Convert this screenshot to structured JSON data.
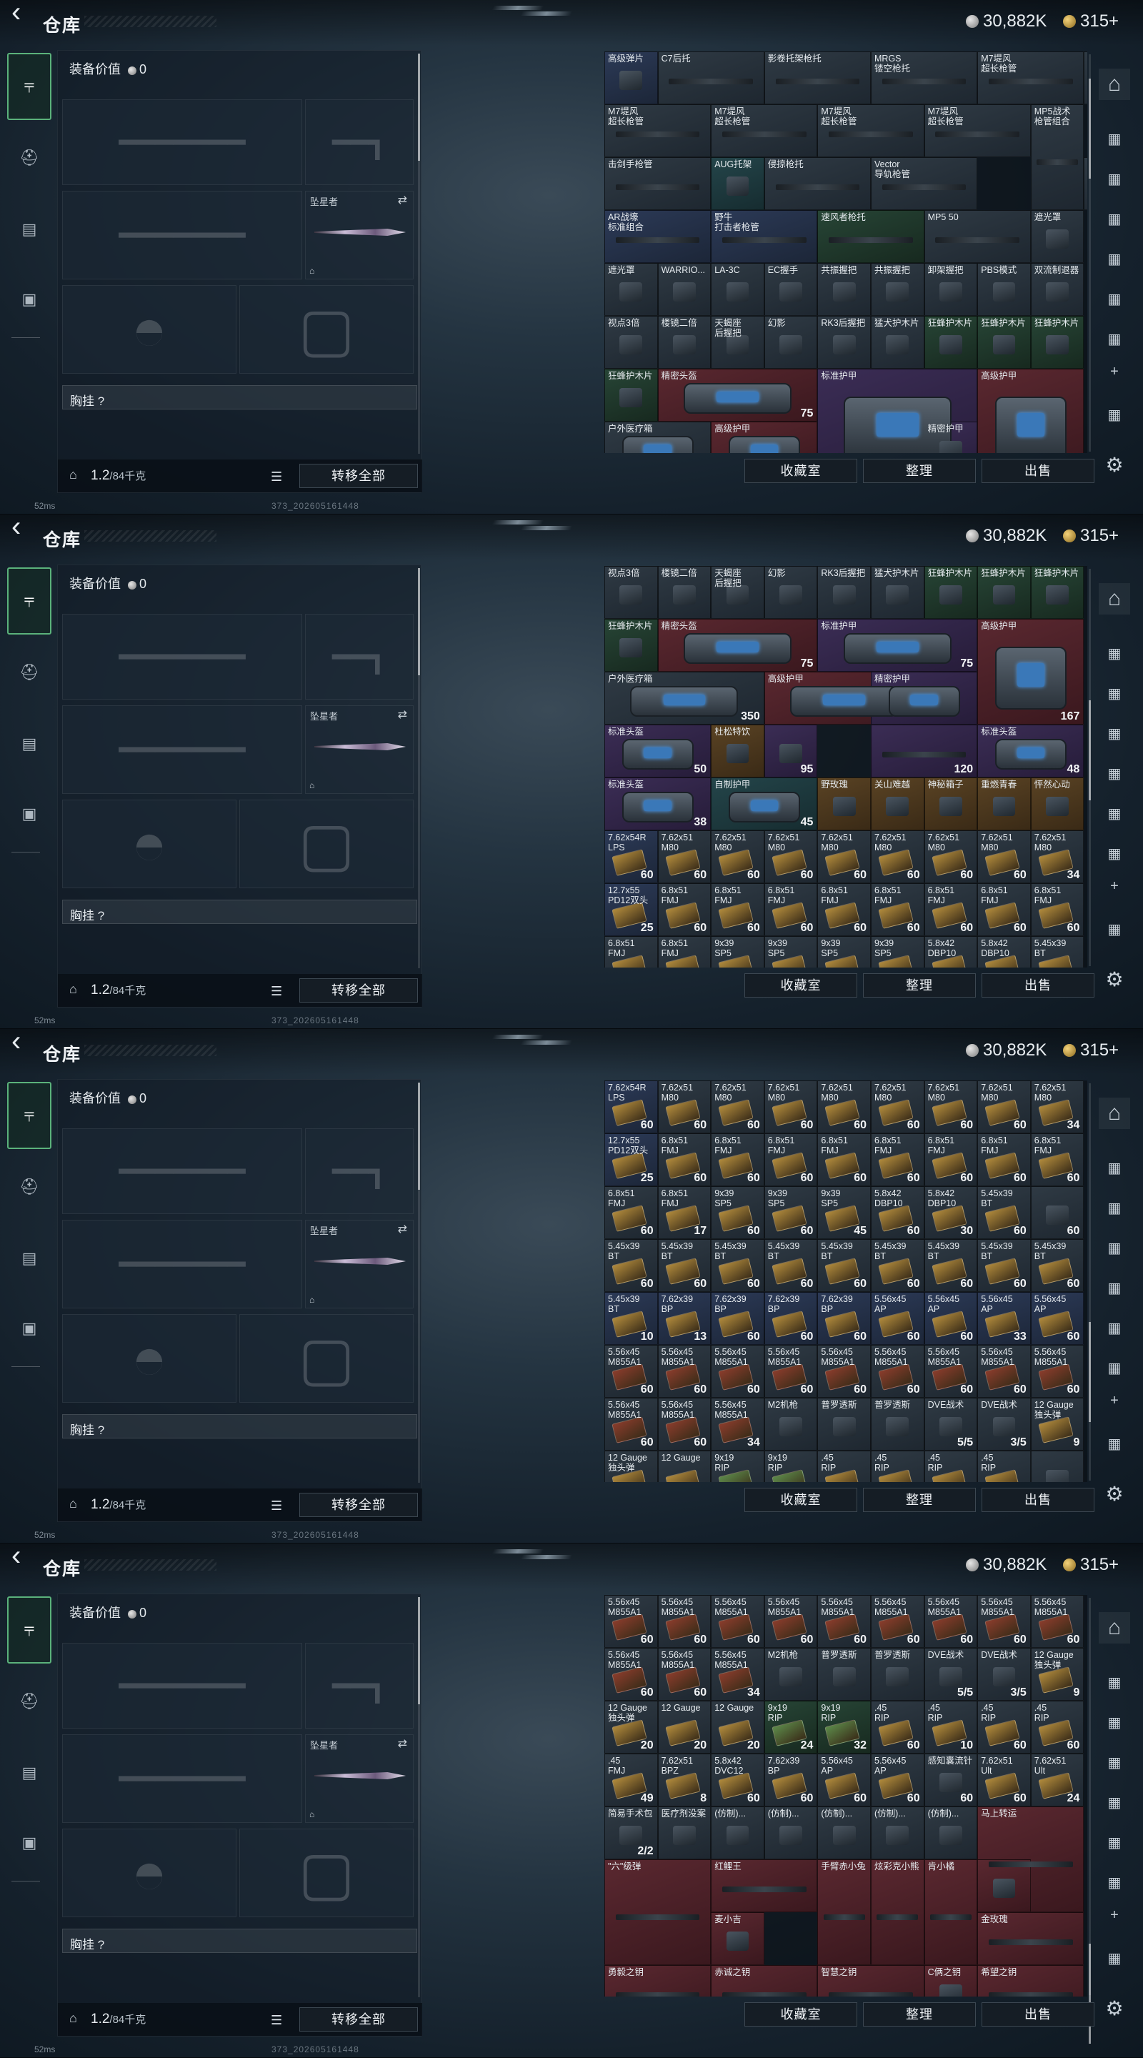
{
  "header": {
    "title": "仓库",
    "silver": "30,882K",
    "gold": "315+"
  },
  "loadout": {
    "equip_value_label": "装备价值",
    "equip_value": "0",
    "melee_label": "坠星者",
    "chest_rig_label": "胸挂 ?",
    "weight": "1.2",
    "weight_max": "/84千克",
    "transfer_all": "转移全部"
  },
  "footer": {
    "collection": "收藏室",
    "sort": "整理",
    "sell": "出售"
  },
  "status": {
    "ping": "52ms",
    "build": "373_202605161448"
  },
  "colors": {
    "accent_green": "#5bb27b",
    "bg_dark": "#0f1a24"
  },
  "icons": {
    "back": "back-arrow-icon",
    "weapon": "gun-icon",
    "helmet": "helmet-icon",
    "backpack": "backpack-icon",
    "briefcase": "briefcase-icon",
    "home": "home-icon",
    "settings": "gear-icon",
    "add": "plus-icon",
    "list": "list-icon",
    "lock": "lock-icon",
    "swap": "swap-icon"
  },
  "screens": [
    {
      "cells": [
        [
          "高级弹片",
          "",
          "blue"
        ],
        [
          "C7后托",
          "",
          "gray"
        ],
        [
          "影卷托架枪托",
          "",
          "gray"
        ],
        [
          "MRGS\n镂空枪托",
          "",
          "gray"
        ],
        [
          "M7堤风\n超长枪管",
          "",
          "gray"
        ],
        [
          "",
          "",
          "gray"
        ],
        [
          "M7堤风\n超长枪管",
          "",
          "gray"
        ],
        [
          "M7堤风\n超长枪管",
          "",
          "gray"
        ],
        [
          "M7堤风\n超长枪管",
          "",
          "gray"
        ],
        [
          "M7堤风\n超长枪管",
          "",
          "gray"
        ],
        [
          "MP5战术\n枪管组合",
          "",
          "gray"
        ],
        [
          "击剑手枪管",
          "",
          "gray"
        ],
        [
          "AUG托架",
          "",
          "teal"
        ],
        [
          "侵掠枪托",
          "",
          "gray"
        ],
        [
          "Vector\n导轨枪管",
          "",
          "gray"
        ],
        [
          "",
          "",
          "gray"
        ],
        [
          "AR战壕\n标准组合",
          "",
          "blue"
        ],
        [
          "野牛\n打击者枪管",
          "",
          "blue"
        ],
        [
          "速风者枪托",
          "",
          "green"
        ],
        [
          "MP5 50",
          "",
          "gray"
        ],
        [
          "遮光罩",
          "",
          "gray"
        ],
        [
          "遮光罩",
          "",
          "gray"
        ],
        [
          "WARRIO...",
          "",
          "gray"
        ],
        [
          "LA-3C",
          "",
          "gray"
        ],
        [
          "EC握手",
          "",
          "gray"
        ],
        [
          "共振握把",
          "",
          "gray"
        ],
        [
          "共振握把",
          "",
          "gray"
        ],
        [
          "卸架握把",
          "",
          "gray"
        ],
        [
          "PBS模式",
          "",
          "gray"
        ],
        [
          "双流制退器",
          "",
          "gray"
        ],
        [
          "视点3倍",
          "",
          "gray"
        ],
        [
          "楼镜二倍",
          "",
          "gray"
        ],
        [
          "天蝎座\n后握把",
          "",
          "gray"
        ],
        [
          "幻影",
          "",
          "gray"
        ],
        [
          "RK3后握把",
          "",
          "gray"
        ],
        [
          "猛犬护木片",
          "",
          "gray"
        ],
        [
          "狂蜂护木片",
          "",
          "green"
        ],
        [
          "狂蜂护木片",
          "",
          "green"
        ],
        [
          "狂蜂护木片",
          "",
          "green"
        ],
        [
          "狂蜂护木片",
          "",
          "green"
        ],
        [
          "精密头盔",
          "75",
          "red"
        ],
        [
          "标准护甲",
          "75",
          "purple"
        ],
        [
          "高级护甲",
          "",
          "red"
        ],
        [
          "户外医疗箱",
          "",
          "gray"
        ],
        [
          "高级护甲",
          "",
          "red"
        ],
        [
          "精密护甲",
          "",
          "purple"
        ]
      ]
    },
    {
      "cells": [
        [
          "视点3倍",
          "",
          "gray"
        ],
        [
          "楼镜二倍",
          "",
          "gray"
        ],
        [
          "天蝎座\n后握把",
          "",
          "gray"
        ],
        [
          "幻影",
          "",
          "gray"
        ],
        [
          "RK3后握把",
          "",
          "gray"
        ],
        [
          "猛犬护木片",
          "",
          "gray"
        ],
        [
          "狂蜂护木片",
          "",
          "green"
        ],
        [
          "狂蜂护木片",
          "",
          "green"
        ],
        [
          "狂蜂护木片",
          "",
          "green"
        ],
        [
          "狂蜂护木片",
          "",
          "green"
        ],
        [
          "精密头盔",
          "75",
          "red"
        ],
        [
          "标准护甲",
          "75",
          "purple"
        ],
        [
          "高级护甲",
          "167",
          "red"
        ],
        [
          "户外医疗箱",
          "350",
          "gray"
        ],
        [
          "高级护甲",
          "",
          "red"
        ],
        [
          "精密护甲",
          "",
          "purple"
        ],
        [
          "标准头盔",
          "50",
          "purple"
        ],
        [
          "杜松特饮",
          "",
          "gold"
        ],
        [
          "",
          "95",
          "purple"
        ],
        [
          "",
          "120",
          "purple"
        ],
        [
          "标准头盔",
          "48",
          "purple"
        ],
        [
          "标准头盔",
          "38",
          "purple"
        ],
        [
          "自制护甲",
          "45",
          "teal"
        ],
        [
          "野玫瑰",
          "",
          "gold"
        ],
        [
          "关山难越",
          "",
          "gold"
        ],
        [
          "神秘箱子",
          "",
          "gold"
        ],
        [
          "重燃青春",
          "",
          "gold"
        ],
        [
          "怦然心动",
          "",
          "gold"
        ],
        [
          "7.62x54R\nLPS",
          "60",
          "blue"
        ],
        [
          "7.62x51\nM80",
          "60",
          "gray"
        ],
        [
          "7.62x51\nM80",
          "60",
          "gray"
        ],
        [
          "7.62x51\nM80",
          "60",
          "gray"
        ],
        [
          "7.62x51\nM80",
          "60",
          "gray"
        ],
        [
          "7.62x51\nM80",
          "60",
          "gray"
        ],
        [
          "7.62x51\nM80",
          "60",
          "gray"
        ],
        [
          "7.62x51\nM80",
          "60",
          "gray"
        ],
        [
          "7.62x51\nM80",
          "34",
          "gray"
        ],
        [
          "12.7x55\nPD12双头",
          "25",
          "blue"
        ],
        [
          "6.8x51\nFMJ",
          "60",
          "gray"
        ],
        [
          "6.8x51\nFMJ",
          "60",
          "gray"
        ],
        [
          "6.8x51\nFMJ",
          "60",
          "gray"
        ],
        [
          "6.8x51\nFMJ",
          "60",
          "gray"
        ],
        [
          "6.8x51\nFMJ",
          "60",
          "gray"
        ],
        [
          "6.8x51\nFMJ",
          "60",
          "gray"
        ],
        [
          "6.8x51\nFMJ",
          "60",
          "gray"
        ],
        [
          "6.8x51\nFMJ",
          "60",
          "gray"
        ],
        [
          "6.8x51\nFMJ",
          "",
          "gray"
        ],
        [
          "6.8x51\nFMJ",
          "",
          "gray"
        ],
        [
          "9x39\nSP5",
          "",
          "gray"
        ],
        [
          "9x39\nSP5",
          "",
          "gray"
        ],
        [
          "9x39\nSP5",
          "",
          "gray"
        ],
        [
          "9x39\nSP5",
          "",
          "gray"
        ],
        [
          "5.8x42\nDBP10",
          "",
          "gray"
        ],
        [
          "5.8x42\nDBP10",
          "",
          "gray"
        ],
        [
          "5.45x39\nBT",
          "",
          "gray"
        ]
      ]
    },
    {
      "cells": [
        [
          "7.62x54R\nLPS",
          "60",
          "blue"
        ],
        [
          "7.62x51\nM80",
          "60",
          "gray"
        ],
        [
          "7.62x51\nM80",
          "60",
          "gray"
        ],
        [
          "7.62x51\nM80",
          "60",
          "gray"
        ],
        [
          "7.62x51\nM80",
          "60",
          "gray"
        ],
        [
          "7.62x51\nM80",
          "60",
          "gray"
        ],
        [
          "7.62x51\nM80",
          "60",
          "gray"
        ],
        [
          "7.62x51\nM80",
          "60",
          "gray"
        ],
        [
          "7.62x51\nM80",
          "34",
          "gray"
        ],
        [
          "12.7x55\nPD12双头",
          "25",
          "blue"
        ],
        [
          "6.8x51\nFMJ",
          "60",
          "gray"
        ],
        [
          "6.8x51\nFMJ",
          "60",
          "gray"
        ],
        [
          "6.8x51\nFMJ",
          "60",
          "gray"
        ],
        [
          "6.8x51\nFMJ",
          "60",
          "gray"
        ],
        [
          "6.8x51\nFMJ",
          "60",
          "gray"
        ],
        [
          "6.8x51\nFMJ",
          "60",
          "gray"
        ],
        [
          "6.8x51\nFMJ",
          "60",
          "gray"
        ],
        [
          "6.8x51\nFMJ",
          "60",
          "gray"
        ],
        [
          "6.8x51\nFMJ",
          "60",
          "gray"
        ],
        [
          "6.8x51\nFMJ",
          "17",
          "gray"
        ],
        [
          "9x39\nSP5",
          "60",
          "gray"
        ],
        [
          "9x39\nSP5",
          "60",
          "gray"
        ],
        [
          "9x39\nSP5",
          "45",
          "gray"
        ],
        [
          "5.8x42\nDBP10",
          "60",
          "gray"
        ],
        [
          "5.8x42\nDBP10",
          "30",
          "gray"
        ],
        [
          "5.45x39\nBT",
          "60",
          "gray"
        ],
        [
          "",
          "60",
          "gray"
        ],
        [
          "5.45x39\nBT",
          "60",
          "gray"
        ],
        [
          "5.45x39\nBT",
          "60",
          "gray"
        ],
        [
          "5.45x39\nBT",
          "60",
          "gray"
        ],
        [
          "5.45x39\nBT",
          "60",
          "gray"
        ],
        [
          "5.45x39\nBT",
          "60",
          "gray"
        ],
        [
          "5.45x39\nBT",
          "60",
          "gray"
        ],
        [
          "5.45x39\nBT",
          "60",
          "gray"
        ],
        [
          "5.45x39\nBT",
          "60",
          "gray"
        ],
        [
          "5.45x39\nBT",
          "60",
          "gray"
        ],
        [
          "5.45x39\nBT",
          "10",
          "blue"
        ],
        [
          "7.62x39\nBP",
          "13",
          "blue"
        ],
        [
          "7.62x39\nBP",
          "60",
          "blue"
        ],
        [
          "7.62x39\nBP",
          "60",
          "blue"
        ],
        [
          "7.62x39\nBP",
          "60",
          "blue"
        ],
        [
          "5.56x45\nAP",
          "60",
          "blue"
        ],
        [
          "5.56x45\nAP",
          "60",
          "blue"
        ],
        [
          "5.56x45\nAP",
          "33",
          "blue"
        ],
        [
          "5.56x45\nAP",
          "60",
          "blue"
        ],
        [
          "5.56x45\nM855A1",
          "60",
          "gray"
        ],
        [
          "5.56x45\nM855A1",
          "60",
          "gray"
        ],
        [
          "5.56x45\nM855A1",
          "60",
          "gray"
        ],
        [
          "5.56x45\nM855A1",
          "60",
          "gray"
        ],
        [
          "5.56x45\nM855A1",
          "60",
          "gray"
        ],
        [
          "5.56x45\nM855A1",
          "60",
          "gray"
        ],
        [
          "5.56x45\nM855A1",
          "60",
          "gray"
        ],
        [
          "5.56x45\nM855A1",
          "60",
          "gray"
        ],
        [
          "5.56x45\nM855A1",
          "60",
          "gray"
        ],
        [
          "5.56x45\nM855A1",
          "60",
          "gray"
        ],
        [
          "5.56x45\nM855A1",
          "60",
          "gray"
        ],
        [
          "5.56x45\nM855A1",
          "34",
          "gray"
        ],
        [
          "M2机枪",
          "",
          "gray"
        ],
        [
          "普罗透斯",
          "",
          "gray"
        ],
        [
          "普罗透斯",
          "",
          "gray"
        ],
        [
          "DVE战术",
          "5/5",
          "gray"
        ],
        [
          "DVE战术",
          "3/5",
          "gray"
        ],
        [
          "12 Gauge\n独头弹",
          "9",
          "gray"
        ],
        [
          "12 Gauge\n独头弹",
          "",
          "gray"
        ],
        [
          "12 Gauge",
          "",
          "gray"
        ],
        [
          "9x19\nRIP",
          "",
          "gray"
        ],
        [
          "9x19\nRIP",
          "",
          "gray"
        ],
        [
          ".45\nRIP",
          "",
          "gray"
        ],
        [
          ".45\nRIP",
          "",
          "gray"
        ],
        [
          ".45\nRIP",
          "",
          "gray"
        ],
        [
          ".45\nRIP",
          "",
          "gray"
        ],
        [
          "",
          "",
          "gray"
        ]
      ]
    },
    {
      "cells": [
        [
          "5.56x45\nM855A1",
          "60",
          "gray"
        ],
        [
          "5.56x45\nM855A1",
          "60",
          "gray"
        ],
        [
          "5.56x45\nM855A1",
          "60",
          "gray"
        ],
        [
          "5.56x45\nM855A1",
          "60",
          "gray"
        ],
        [
          "5.56x45\nM855A1",
          "60",
          "gray"
        ],
        [
          "5.56x45\nM855A1",
          "60",
          "gray"
        ],
        [
          "5.56x45\nM855A1",
          "60",
          "gray"
        ],
        [
          "5.56x45\nM855A1",
          "60",
          "gray"
        ],
        [
          "5.56x45\nM855A1",
          "60",
          "gray"
        ],
        [
          "5.56x45\nM855A1",
          "60",
          "gray"
        ],
        [
          "5.56x45\nM855A1",
          "60",
          "gray"
        ],
        [
          "5.56x45\nM855A1",
          "34",
          "gray"
        ],
        [
          "M2机枪",
          "",
          "gray"
        ],
        [
          "普罗透斯",
          "",
          "gray"
        ],
        [
          "普罗透斯",
          "",
          "gray"
        ],
        [
          "DVE战术",
          "5/5",
          "gray"
        ],
        [
          "DVE战术",
          "3/5",
          "gray"
        ],
        [
          "12 Gauge\n独头弹",
          "9",
          "gray"
        ],
        [
          "12 Gauge\n独头弹",
          "20",
          "gray"
        ],
        [
          "12 Gauge",
          "20",
          "gray"
        ],
        [
          "12 Gauge",
          "20",
          "gray"
        ],
        [
          "9x19\nRIP",
          "24",
          "green"
        ],
        [
          "9x19\nRIP",
          "32",
          "green"
        ],
        [
          ".45\nRIP",
          "60",
          "gray"
        ],
        [
          ".45\nRIP",
          "10",
          "gray"
        ],
        [
          ".45\nRIP",
          "60",
          "gray"
        ],
        [
          ".45\nRIP",
          "60",
          "gray"
        ],
        [
          ".45\nFMJ",
          "49",
          "gray"
        ],
        [
          "7.62x51\nBPZ",
          "8",
          "gray"
        ],
        [
          "5.8x42\nDVC12",
          "60",
          "gray"
        ],
        [
          "7.62x39\nBP",
          "60",
          "gray"
        ],
        [
          "5.56x45\nAP",
          "60",
          "gray"
        ],
        [
          "5.56x45\nAP",
          "60",
          "gray"
        ],
        [
          "感知囊流针",
          "60",
          "gray"
        ],
        [
          "7.62x51\nUlt",
          "60",
          "gray"
        ],
        [
          "7.62x51\nUlt",
          "24",
          "gray"
        ],
        [
          "简易手术包",
          "2/2",
          "gray"
        ],
        [
          "医疗剂没案",
          "",
          "gray"
        ],
        [
          "(仿制)...",
          "",
          "gray"
        ],
        [
          "(仿制)...",
          "",
          "gray"
        ],
        [
          "(仿制)...",
          "",
          "gray"
        ],
        [
          "(仿制)...",
          "",
          "gray"
        ],
        [
          "(仿制)...",
          "",
          "gray"
        ],
        [
          "马上转运",
          "",
          "red"
        ],
        [
          "\"六\"级弹",
          "",
          "red"
        ],
        [
          "红鲤王",
          "",
          "red"
        ],
        [
          "手臂赤小兔",
          "",
          "red"
        ],
        [
          "炫彩克小熊",
          "",
          "red"
        ],
        [
          "肯小橘",
          "",
          "red"
        ],
        [
          "",
          "",
          "red"
        ],
        [
          "麦小吉",
          "",
          "red"
        ],
        [
          "金玫瑰",
          "",
          "red"
        ],
        [
          "勇毅之钥",
          "",
          "red"
        ],
        [
          "赤诚之钥",
          "",
          "red"
        ],
        [
          "智慧之钥",
          "",
          "red"
        ],
        [
          "C俩之钥",
          "",
          "red"
        ],
        [
          "希望之钥",
          "",
          "red"
        ]
      ]
    }
  ]
}
